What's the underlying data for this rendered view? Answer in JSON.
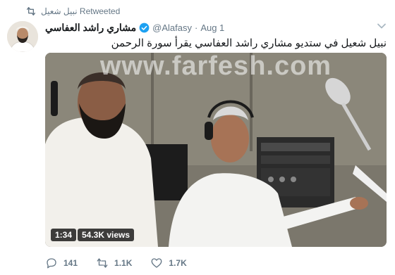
{
  "retweet": {
    "text": "نبيل شعيل Retweeted",
    "icon": "retweet-icon"
  },
  "tweet": {
    "author": {
      "name": "مشاري راشد العفاسي",
      "verified": true,
      "handle": "@Alafasy",
      "separator": "·",
      "time": "Aug 1",
      "avatar_icon": "avatar"
    },
    "text": "نبيل شعيل في ستديو مشاري راشد العفاسي يقرأ سورة الرحمن",
    "media": {
      "watermark": "www.farfesh.com",
      "duration": "1:34",
      "views": "54.3K views"
    }
  },
  "actions": {
    "reply": {
      "count": "141",
      "icon": "reply-icon"
    },
    "retweet": {
      "count": "1.1K",
      "icon": "retweet-icon"
    },
    "like": {
      "count": "1.7K",
      "icon": "heart-icon"
    }
  },
  "colors": {
    "text": "#14171a",
    "muted": "#657786",
    "verified": "#1da1f2"
  }
}
